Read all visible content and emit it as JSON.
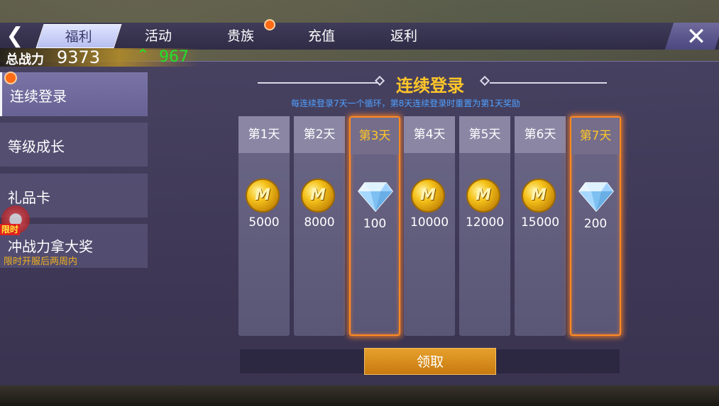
{
  "nav": {
    "back_icon": "back-arrow-icon",
    "tabs": [
      {
        "label": "福利",
        "active": true
      },
      {
        "label": "活动",
        "active": false
      },
      {
        "label": "贵族",
        "active": false,
        "notification": true
      },
      {
        "label": "充值",
        "active": false
      },
      {
        "label": "返利",
        "active": false
      }
    ],
    "close_icon": "close-icon"
  },
  "power": {
    "label": "总战力",
    "value": "9373",
    "increase": "967"
  },
  "sidebar": {
    "items": [
      {
        "label": "连续登录",
        "active": true,
        "notification": true
      },
      {
        "label": "等级成长",
        "active": false
      },
      {
        "label": "礼品卡",
        "active": false
      },
      {
        "label": "冲战力拿大奖",
        "active": false,
        "badge": "限时",
        "sub": "限时开服后两周内"
      }
    ]
  },
  "content": {
    "title": "连续登录",
    "subtitle": "每连续登录7天一个循环，第8天连续登录时重置为第1天奖励",
    "days": [
      {
        "label": "第1天",
        "reward": "coin",
        "amount": "5000",
        "highlight": false
      },
      {
        "label": "第2天",
        "reward": "coin",
        "amount": "8000",
        "highlight": false
      },
      {
        "label": "第3天",
        "reward": "diamond",
        "amount": "100",
        "highlight": true
      },
      {
        "label": "第4天",
        "reward": "coin",
        "amount": "10000",
        "highlight": false
      },
      {
        "label": "第5天",
        "reward": "coin",
        "amount": "12000",
        "highlight": false
      },
      {
        "label": "第6天",
        "reward": "coin",
        "amount": "15000",
        "highlight": false
      },
      {
        "label": "第7天",
        "reward": "diamond",
        "amount": "200",
        "highlight": true
      }
    ],
    "claim_label": "领取"
  },
  "colors": {
    "accent_gold": "#ffc629",
    "highlight_orange": "#ff8a20",
    "subtitle_blue": "#4fa0ff",
    "power_green": "#22e02a"
  }
}
